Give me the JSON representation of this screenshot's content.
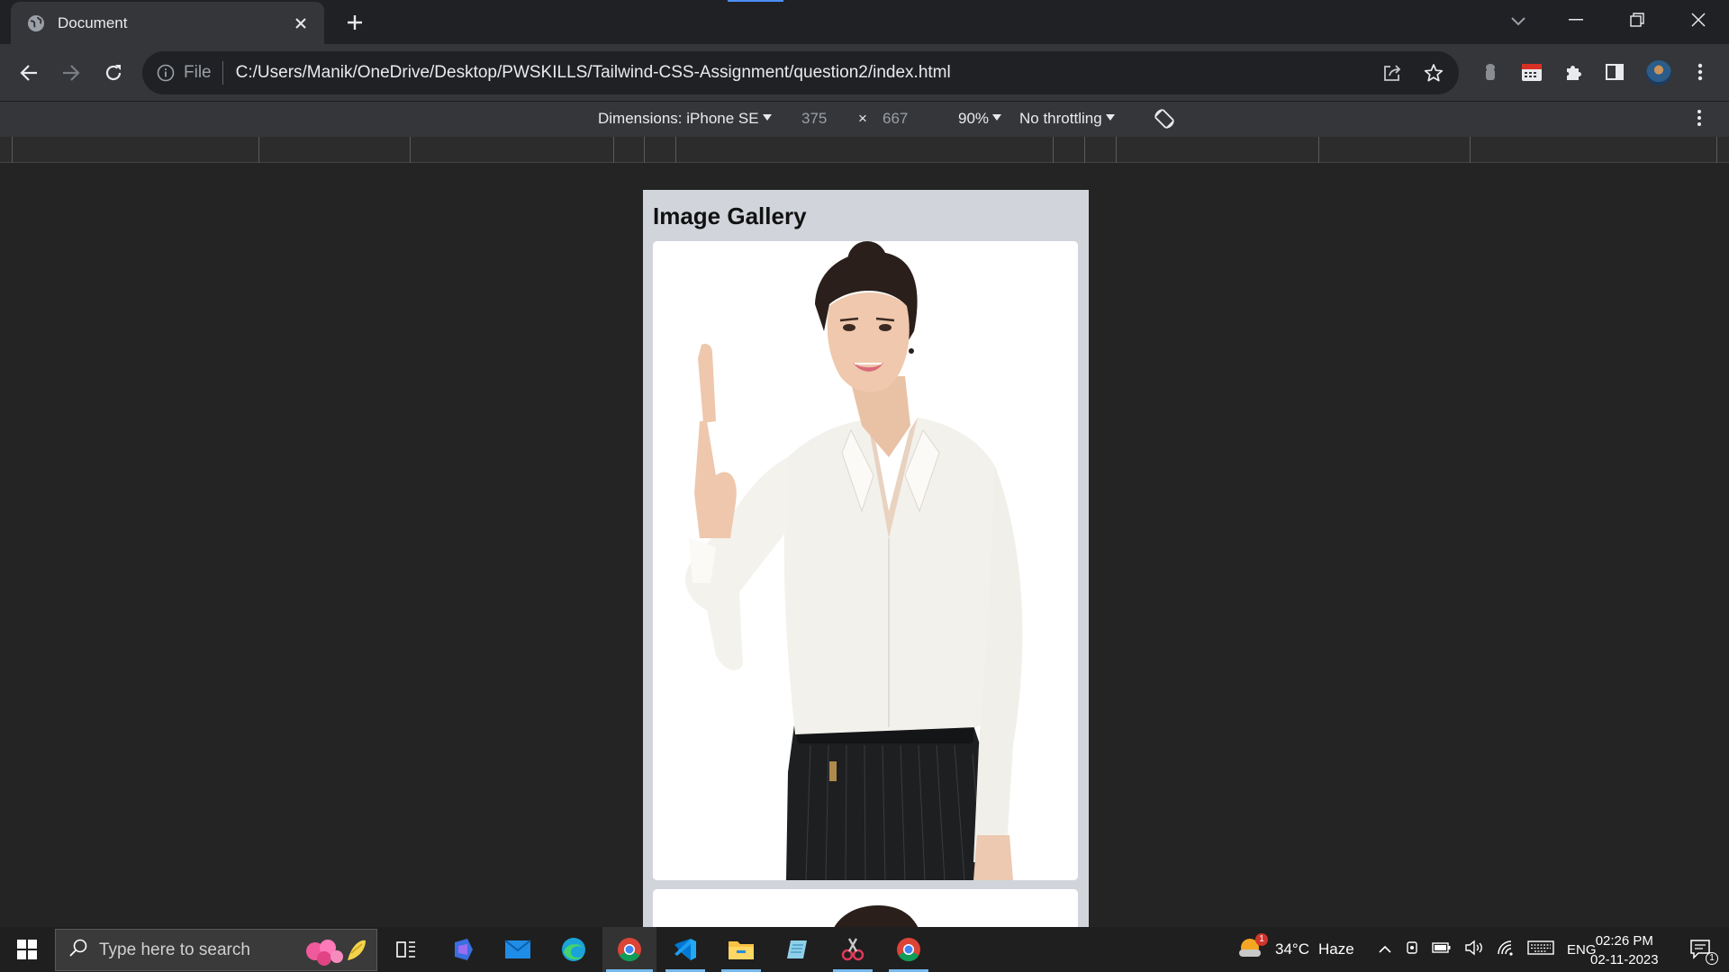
{
  "browser": {
    "tab": {
      "title": "Document",
      "favicon": "globe-icon"
    },
    "address": {
      "scheme_label": "File",
      "url": "C:/Users/Manik/OneDrive/Desktop/PWSKILLS/Tailwind-CSS-Assignment/question2/index.html"
    }
  },
  "devtools": {
    "dimensions_label": "Dimensions: iPhone SE",
    "width": "375",
    "separator": "×",
    "height": "667",
    "zoom": "90%",
    "throttling": "No throttling"
  },
  "page": {
    "heading": "Image Gallery",
    "background_color": "#d1d5db",
    "cards": [
      {
        "image": "woman-pointing-up-photo"
      },
      {
        "image": "woman-portrait-photo"
      }
    ]
  },
  "taskbar": {
    "search_placeholder": "Type here to search",
    "weather_temp": "34°C",
    "weather_desc": "Haze",
    "language": "ENG",
    "time": "02:26 PM",
    "date": "02-11-2023",
    "notification_count": "1",
    "weather_badge": "1"
  }
}
